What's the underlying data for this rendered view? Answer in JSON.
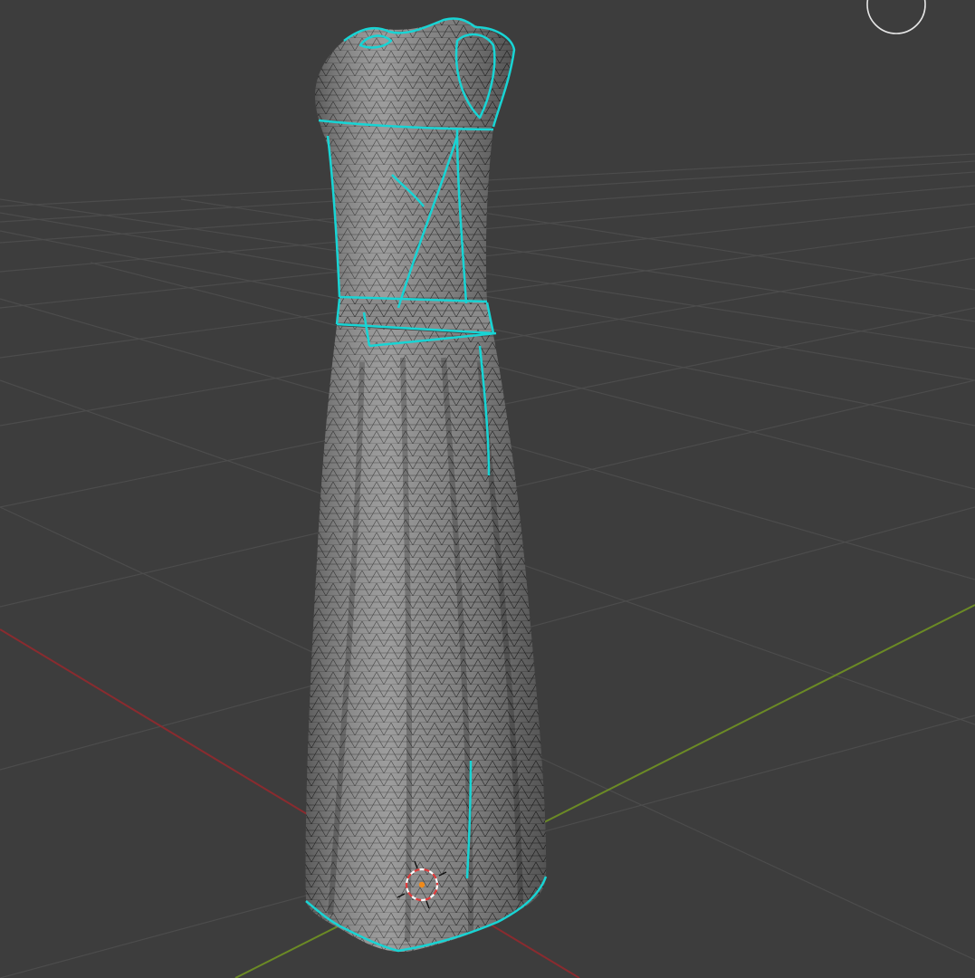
{
  "viewport": {
    "background_color": "#3d3d3d",
    "grid_color": "#4b4b4b",
    "x_axis_color": "#8a2b2f",
    "y_axis_color": "#6b8a25",
    "mesh_fill_color": "#8a8a8a",
    "mesh_wire_color": "#1a1a1a",
    "seam_color": "#18d4d4"
  },
  "object": {
    "icon": "dress-mesh-icon"
  },
  "cursor": {
    "icon": "3d-cursor-icon",
    "colors": [
      "#e23b3b",
      "#ffffff"
    ]
  },
  "navigation": {
    "icon": "view-navigation-gizmo-icon"
  }
}
